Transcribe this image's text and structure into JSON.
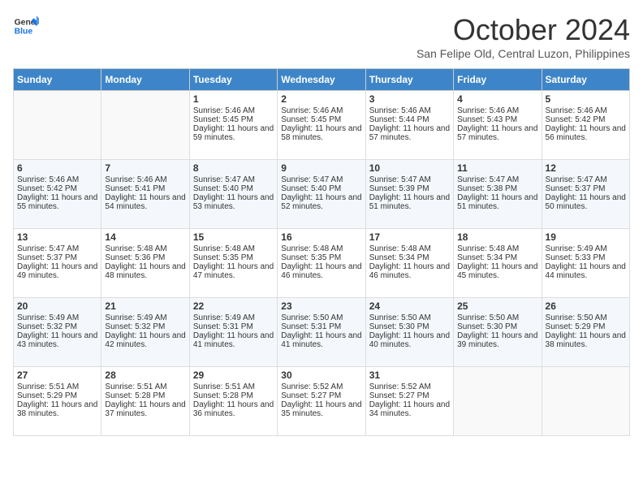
{
  "header": {
    "logo_line1": "General",
    "logo_line2": "Blue",
    "month": "October 2024",
    "location": "San Felipe Old, Central Luzon, Philippines"
  },
  "columns": [
    "Sunday",
    "Monday",
    "Tuesday",
    "Wednesday",
    "Thursday",
    "Friday",
    "Saturday"
  ],
  "weeks": [
    [
      {
        "day": "",
        "sunrise": "",
        "sunset": "",
        "daylight": ""
      },
      {
        "day": "",
        "sunrise": "",
        "sunset": "",
        "daylight": ""
      },
      {
        "day": "1",
        "sunrise": "Sunrise: 5:46 AM",
        "sunset": "Sunset: 5:45 PM",
        "daylight": "Daylight: 11 hours and 59 minutes."
      },
      {
        "day": "2",
        "sunrise": "Sunrise: 5:46 AM",
        "sunset": "Sunset: 5:45 PM",
        "daylight": "Daylight: 11 hours and 58 minutes."
      },
      {
        "day": "3",
        "sunrise": "Sunrise: 5:46 AM",
        "sunset": "Sunset: 5:44 PM",
        "daylight": "Daylight: 11 hours and 57 minutes."
      },
      {
        "day": "4",
        "sunrise": "Sunrise: 5:46 AM",
        "sunset": "Sunset: 5:43 PM",
        "daylight": "Daylight: 11 hours and 57 minutes."
      },
      {
        "day": "5",
        "sunrise": "Sunrise: 5:46 AM",
        "sunset": "Sunset: 5:42 PM",
        "daylight": "Daylight: 11 hours and 56 minutes."
      }
    ],
    [
      {
        "day": "6",
        "sunrise": "Sunrise: 5:46 AM",
        "sunset": "Sunset: 5:42 PM",
        "daylight": "Daylight: 11 hours and 55 minutes."
      },
      {
        "day": "7",
        "sunrise": "Sunrise: 5:46 AM",
        "sunset": "Sunset: 5:41 PM",
        "daylight": "Daylight: 11 hours and 54 minutes."
      },
      {
        "day": "8",
        "sunrise": "Sunrise: 5:47 AM",
        "sunset": "Sunset: 5:40 PM",
        "daylight": "Daylight: 11 hours and 53 minutes."
      },
      {
        "day": "9",
        "sunrise": "Sunrise: 5:47 AM",
        "sunset": "Sunset: 5:40 PM",
        "daylight": "Daylight: 11 hours and 52 minutes."
      },
      {
        "day": "10",
        "sunrise": "Sunrise: 5:47 AM",
        "sunset": "Sunset: 5:39 PM",
        "daylight": "Daylight: 11 hours and 51 minutes."
      },
      {
        "day": "11",
        "sunrise": "Sunrise: 5:47 AM",
        "sunset": "Sunset: 5:38 PM",
        "daylight": "Daylight: 11 hours and 51 minutes."
      },
      {
        "day": "12",
        "sunrise": "Sunrise: 5:47 AM",
        "sunset": "Sunset: 5:37 PM",
        "daylight": "Daylight: 11 hours and 50 minutes."
      }
    ],
    [
      {
        "day": "13",
        "sunrise": "Sunrise: 5:47 AM",
        "sunset": "Sunset: 5:37 PM",
        "daylight": "Daylight: 11 hours and 49 minutes."
      },
      {
        "day": "14",
        "sunrise": "Sunrise: 5:48 AM",
        "sunset": "Sunset: 5:36 PM",
        "daylight": "Daylight: 11 hours and 48 minutes."
      },
      {
        "day": "15",
        "sunrise": "Sunrise: 5:48 AM",
        "sunset": "Sunset: 5:35 PM",
        "daylight": "Daylight: 11 hours and 47 minutes."
      },
      {
        "day": "16",
        "sunrise": "Sunrise: 5:48 AM",
        "sunset": "Sunset: 5:35 PM",
        "daylight": "Daylight: 11 hours and 46 minutes."
      },
      {
        "day": "17",
        "sunrise": "Sunrise: 5:48 AM",
        "sunset": "Sunset: 5:34 PM",
        "daylight": "Daylight: 11 hours and 46 minutes."
      },
      {
        "day": "18",
        "sunrise": "Sunrise: 5:48 AM",
        "sunset": "Sunset: 5:34 PM",
        "daylight": "Daylight: 11 hours and 45 minutes."
      },
      {
        "day": "19",
        "sunrise": "Sunrise: 5:49 AM",
        "sunset": "Sunset: 5:33 PM",
        "daylight": "Daylight: 11 hours and 44 minutes."
      }
    ],
    [
      {
        "day": "20",
        "sunrise": "Sunrise: 5:49 AM",
        "sunset": "Sunset: 5:32 PM",
        "daylight": "Daylight: 11 hours and 43 minutes."
      },
      {
        "day": "21",
        "sunrise": "Sunrise: 5:49 AM",
        "sunset": "Sunset: 5:32 PM",
        "daylight": "Daylight: 11 hours and 42 minutes."
      },
      {
        "day": "22",
        "sunrise": "Sunrise: 5:49 AM",
        "sunset": "Sunset: 5:31 PM",
        "daylight": "Daylight: 11 hours and 41 minutes."
      },
      {
        "day": "23",
        "sunrise": "Sunrise: 5:50 AM",
        "sunset": "Sunset: 5:31 PM",
        "daylight": "Daylight: 11 hours and 41 minutes."
      },
      {
        "day": "24",
        "sunrise": "Sunrise: 5:50 AM",
        "sunset": "Sunset: 5:30 PM",
        "daylight": "Daylight: 11 hours and 40 minutes."
      },
      {
        "day": "25",
        "sunrise": "Sunrise: 5:50 AM",
        "sunset": "Sunset: 5:30 PM",
        "daylight": "Daylight: 11 hours and 39 minutes."
      },
      {
        "day": "26",
        "sunrise": "Sunrise: 5:50 AM",
        "sunset": "Sunset: 5:29 PM",
        "daylight": "Daylight: 11 hours and 38 minutes."
      }
    ],
    [
      {
        "day": "27",
        "sunrise": "Sunrise: 5:51 AM",
        "sunset": "Sunset: 5:29 PM",
        "daylight": "Daylight: 11 hours and 38 minutes."
      },
      {
        "day": "28",
        "sunrise": "Sunrise: 5:51 AM",
        "sunset": "Sunset: 5:28 PM",
        "daylight": "Daylight: 11 hours and 37 minutes."
      },
      {
        "day": "29",
        "sunrise": "Sunrise: 5:51 AM",
        "sunset": "Sunset: 5:28 PM",
        "daylight": "Daylight: 11 hours and 36 minutes."
      },
      {
        "day": "30",
        "sunrise": "Sunrise: 5:52 AM",
        "sunset": "Sunset: 5:27 PM",
        "daylight": "Daylight: 11 hours and 35 minutes."
      },
      {
        "day": "31",
        "sunrise": "Sunrise: 5:52 AM",
        "sunset": "Sunset: 5:27 PM",
        "daylight": "Daylight: 11 hours and 34 minutes."
      },
      {
        "day": "",
        "sunrise": "",
        "sunset": "",
        "daylight": ""
      },
      {
        "day": "",
        "sunrise": "",
        "sunset": "",
        "daylight": ""
      }
    ]
  ]
}
